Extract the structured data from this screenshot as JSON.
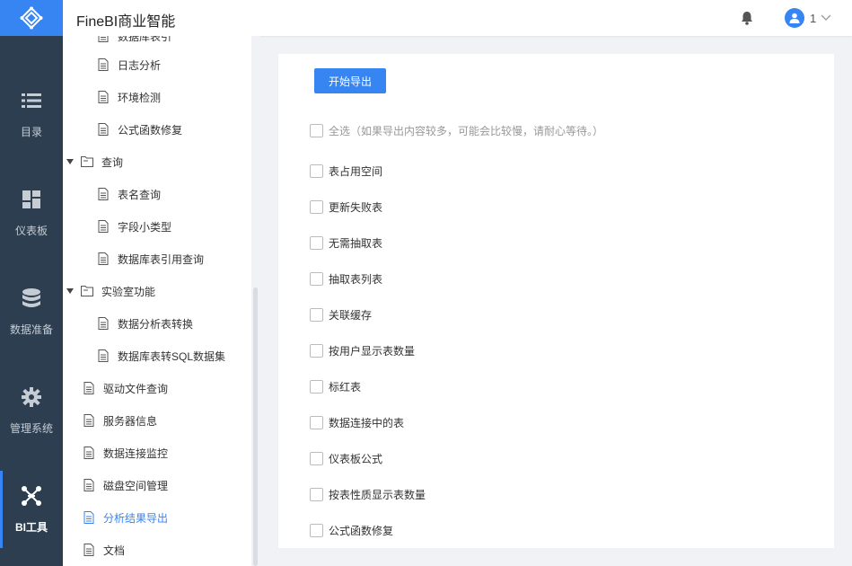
{
  "header": {
    "title": "FineBI商业智能",
    "user": "1"
  },
  "leftnav": [
    {
      "label": "目录",
      "icon": "list-icon"
    },
    {
      "label": "仪表板",
      "icon": "dashboard-icon"
    },
    {
      "label": "数据准备",
      "icon": "database-icon"
    },
    {
      "label": "管理系统",
      "icon": "gear-icon"
    },
    {
      "label": "BI工具",
      "icon": "network-icon",
      "active": true
    }
  ],
  "tree": {
    "partial_label": "数据库表引",
    "items": [
      {
        "label": "日志分析"
      },
      {
        "label": "环境检测"
      },
      {
        "label": "公式函数修复"
      },
      {
        "label": "查询"
      },
      {
        "label": "表名查询"
      },
      {
        "label": "字段小类型"
      },
      {
        "label": "数据库表引用查询"
      },
      {
        "label": "实验室功能"
      },
      {
        "label": "数据分析表转换"
      },
      {
        "label": "数据库表转SQL数据集"
      },
      {
        "label": "驱动文件查询"
      },
      {
        "label": "服务器信息"
      },
      {
        "label": "数据连接监控"
      },
      {
        "label": "磁盘空间管理"
      },
      {
        "label": "分析结果导出",
        "active": true
      },
      {
        "label": "文档"
      }
    ]
  },
  "panel": {
    "export_button": "开始导出",
    "select_all": "全选（如果导出内容较多，可能会比较慢，请耐心等待。）",
    "options": [
      "表占用空间",
      "更新失败表",
      "无需抽取表",
      "抽取表列表",
      "关联缓存",
      "按用户显示表数量",
      "标红表",
      "数据连接中的表",
      "仪表板公式",
      "按表性质显示表数量",
      "公式函数修复"
    ]
  },
  "colors": {
    "accent": "#3685f2",
    "nav_bg": "#2c3e50"
  }
}
